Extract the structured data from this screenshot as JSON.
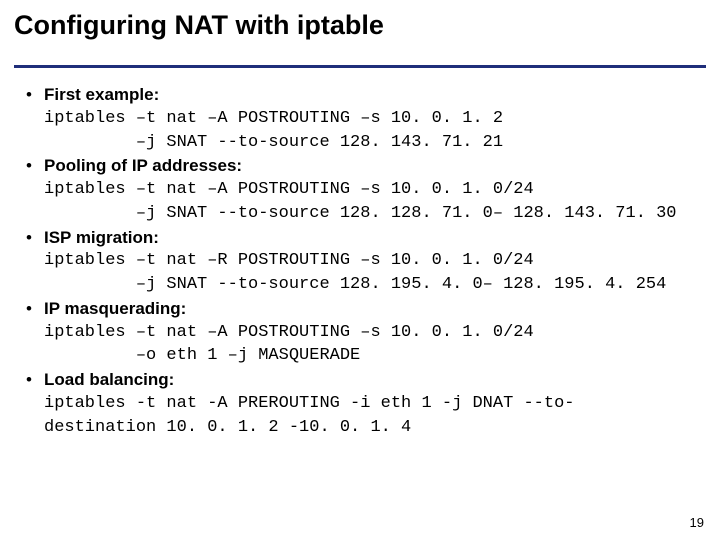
{
  "title": "Configuring NAT with iptable",
  "bullet_char": "•",
  "items": [
    {
      "label": "First example:",
      "cmd": "iptables –t nat –A POSTROUTING –s 10. 0. 1. 2\n         –j SNAT --to-source 128. 143. 71. 21"
    },
    {
      "label": "Pooling of IP addresses:",
      "cmd": "iptables –t nat –A POSTROUTING –s 10. 0. 1. 0/24\n         –j SNAT --to-source 128. 128. 71. 0– 128. 143. 71. 30"
    },
    {
      "label": "ISP migration:",
      "cmd": "iptables –t nat –R POSTROUTING –s 10. 0. 1. 0/24\n         –j SNAT --to-source 128. 195. 4. 0– 128. 195. 4. 254"
    },
    {
      "label": "IP masquerading:",
      "cmd": "iptables –t nat –A POSTROUTING –s 10. 0. 1. 0/24\n         –o eth 1 –j MASQUERADE"
    },
    {
      "label": "Load balancing:",
      "cmd": "iptables -t nat -A PREROUTING -i eth 1 -j DNAT --to-\ndestination 10. 0. 1. 2 -10. 0. 1. 4"
    }
  ],
  "page_number": "19"
}
